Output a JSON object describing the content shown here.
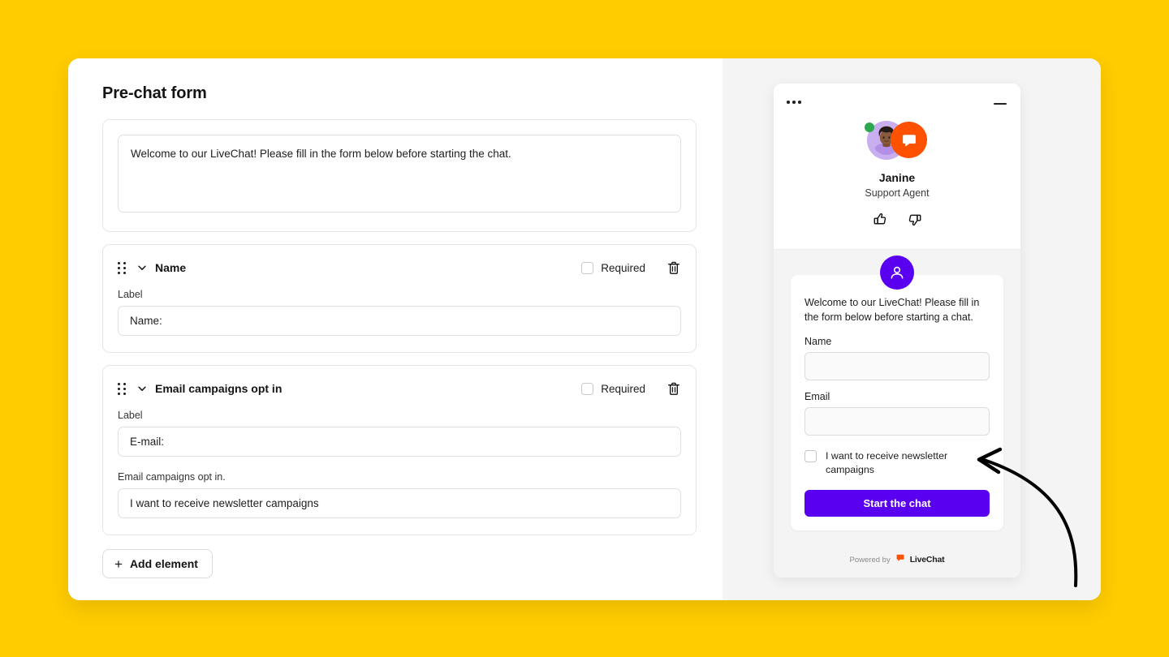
{
  "page": {
    "background_color": "#FFCC00",
    "title": "Pre-chat form"
  },
  "builder": {
    "welcome_message": {
      "name": "welcome-message-textarea",
      "value": "Welcome to our LiveChat! Please fill in the form below before starting the chat."
    },
    "add_element_label": "Add element",
    "add_element_icon": "plus-icon",
    "fields": [
      {
        "title": "Name",
        "drag_icon": "drag-handle-icon",
        "collapse_icon": "chevron-down-icon",
        "required_label": "Required",
        "required_checked": false,
        "delete_icon": "trash-icon",
        "label_caption": "Label",
        "label_value": "Name:",
        "has_option": false
      },
      {
        "title": "Email campaigns opt in",
        "drag_icon": "drag-handle-icon",
        "collapse_icon": "chevron-down-icon",
        "required_label": "Required",
        "required_checked": false,
        "delete_icon": "trash-icon",
        "label_caption": "Label",
        "label_value": "E-mail:",
        "has_option": true,
        "option_caption": "Email campaigns opt in.",
        "option_value": "I want to receive newsletter campaigns"
      }
    ]
  },
  "preview": {
    "widget": {
      "menu_icon": "more-options-icon",
      "minimize_icon": "minimize-icon",
      "agent": {
        "name": "Janine",
        "role": "Support Agent",
        "avatar_icon": "agent-avatar",
        "status": "online",
        "status_color": "#2EA84F",
        "brand_badge_icon": "livechat-logo-icon",
        "brand_color": "#FF5100",
        "avatar_bg_color": "#C9AEF0"
      },
      "rating": {
        "thumbs_up_icon": "thumbs-up-icon",
        "thumbs_down_icon": "thumbs-down-icon"
      },
      "prechat": {
        "user_badge_icon": "user-icon",
        "accent_color": "#5A00F0",
        "welcome_text": "Welcome to our LiveChat! Please fill in the form below before starting a chat.",
        "name_label": "Name",
        "name_value": "",
        "email_label": "Email",
        "email_value": "",
        "optin_label": "I want to receive newsletter campaigns",
        "optin_checked": false,
        "submit_label": "Start the chat"
      },
      "footer": {
        "powered_by": "Powered by",
        "brand_name": "LiveChat",
        "brand_icon": "livechat-logo-icon"
      }
    },
    "annotation": {
      "arrow_icon": "curved-arrow-icon",
      "color": "#000000"
    }
  }
}
